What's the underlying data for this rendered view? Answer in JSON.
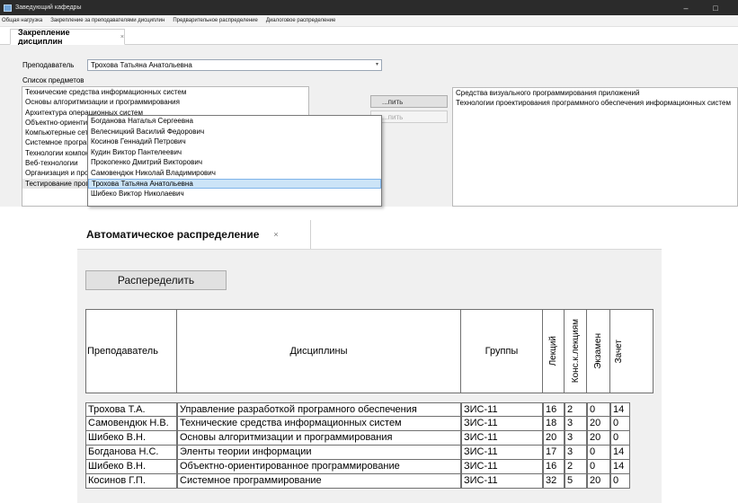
{
  "window": {
    "title": "Заведующий кафедры",
    "minimize": "–",
    "maximize": "□"
  },
  "menu": [
    "Общая нагрузка",
    "Закрепление за преподавателями дисциплин",
    "Предварительное распределение",
    "Диалоговое распределение"
  ],
  "tab1": {
    "label": "Закрепление дисциплин",
    "close": "×"
  },
  "form": {
    "teacher_label": "Преподаватель",
    "teacher_selected": "Трохова Татьяна Анатольевна",
    "combo_arrow": "▾",
    "subjects_label": "Список предметов",
    "subjects": [
      "Технические средства информационных систем",
      "Основы алгоритмизации и программирования",
      "Архитектура операционных систем",
      "Объектно-ориентированное программирование",
      "Компьютерные сети",
      "Системное программирование",
      "Технологии компонентного программирования",
      "Веб-технологии",
      "Организация и проектирование баз данных",
      "Тестирование программного обеспечения"
    ],
    "assign_button": "...пить",
    "unassign_button": "...пить",
    "assigned": [
      "Средства визуального программирования приложений",
      "Технологии проектирования программного обеспечения информационных систем"
    ]
  },
  "dropdown": {
    "items": [
      "Богданова Наталья Сергеевна",
      "Велесницкий Василий Федорович",
      "Косинов Геннадий Петрович",
      "Кудин Виктор Пантелеевич",
      "Прокопенко Дмитрий Викторович",
      "Самовендюк Николай Владимирович",
      "Трохова Татьяна Анатольевна",
      "Шибеко Виктор Николаевич"
    ],
    "highlighted_index": 6
  },
  "tab2": {
    "label": "Автоматическое распределение",
    "close": "×"
  },
  "distribute_button": "Распеределить",
  "grid": {
    "headers": [
      "Преподаватель",
      "Дисциплины",
      "Группы",
      "Лекций",
      "Конс.к.лекциям",
      "Экзамен",
      "Зачет"
    ],
    "rows": [
      [
        "Трохова Т.А.",
        "Управление разработкой програмного обеспечения",
        "ЗИС-11",
        "16",
        "2",
        "0",
        "14"
      ],
      [
        "Самовендюк Н.В.",
        "Технические средства информационных систем",
        "ЗИС-11",
        "18",
        "3",
        "20",
        "0"
      ],
      [
        "Шибеко В.Н.",
        "Основы алгоритмизации и программирования",
        "ЗИС-11",
        "20",
        "3",
        "20",
        "0"
      ],
      [
        "Богданова Н.С.",
        "Эленты теории информации",
        "ЗИС-11",
        "17",
        "3",
        "0",
        "14"
      ],
      [
        "Шибеко В.Н.",
        "Объектно-ориентированное программирование",
        "ЗИС-11",
        "16",
        "2",
        "0",
        "14"
      ],
      [
        "Косинов Г.П.",
        "Системное программирование",
        "ЗИС-11",
        "32",
        "5",
        "20",
        "0"
      ]
    ]
  }
}
